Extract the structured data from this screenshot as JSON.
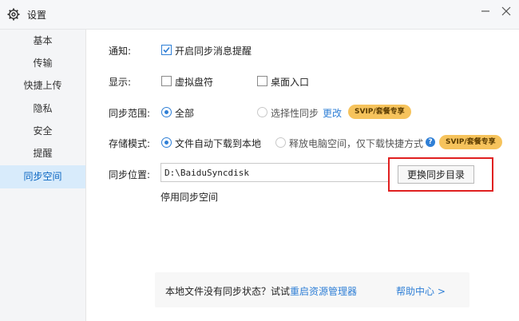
{
  "window": {
    "title": "设置"
  },
  "sidebar": {
    "items": [
      {
        "label": "基本"
      },
      {
        "label": "传输"
      },
      {
        "label": "快捷上传"
      },
      {
        "label": "隐私"
      },
      {
        "label": "安全"
      },
      {
        "label": "提醒"
      },
      {
        "label": "同步空间"
      }
    ],
    "active": "同步空间"
  },
  "settings": {
    "notify": {
      "label": "通知:",
      "option": "开启同步消息提醒",
      "checked": true
    },
    "display": {
      "label": "显示:",
      "options": [
        {
          "text": "虚拟盘符",
          "checked": false
        },
        {
          "text": "桌面入口",
          "checked": false
        }
      ]
    },
    "scope": {
      "label": "同步范围:",
      "option_all": "全部",
      "option_selective": "选择性同步",
      "change_link": "更改",
      "badge": "SVIP/套餐专享",
      "selected": "全部"
    },
    "storage": {
      "label": "存储模式:",
      "option_auto": "文件自动下载到本地",
      "option_free": "释放电脑空间，仅下载快捷方式",
      "help": "?",
      "badge": "SVIP/套餐专享",
      "selected": "文件自动下载到本地"
    },
    "location": {
      "label": "同步位置:",
      "path": "D:\\BaiduSyncdisk",
      "change_button": "更换同步目录",
      "disable_link": "停用同步空间"
    }
  },
  "footer": {
    "message": "本地文件没有同步状态？试试",
    "restart_link": "重启资源管理器",
    "help_link": "帮助中心 >"
  },
  "colors": {
    "accent": "#2f7fd6",
    "highlight": "#e02020",
    "badge": "#f6c35c",
    "active_nav_bg": "#d8ebfb"
  }
}
